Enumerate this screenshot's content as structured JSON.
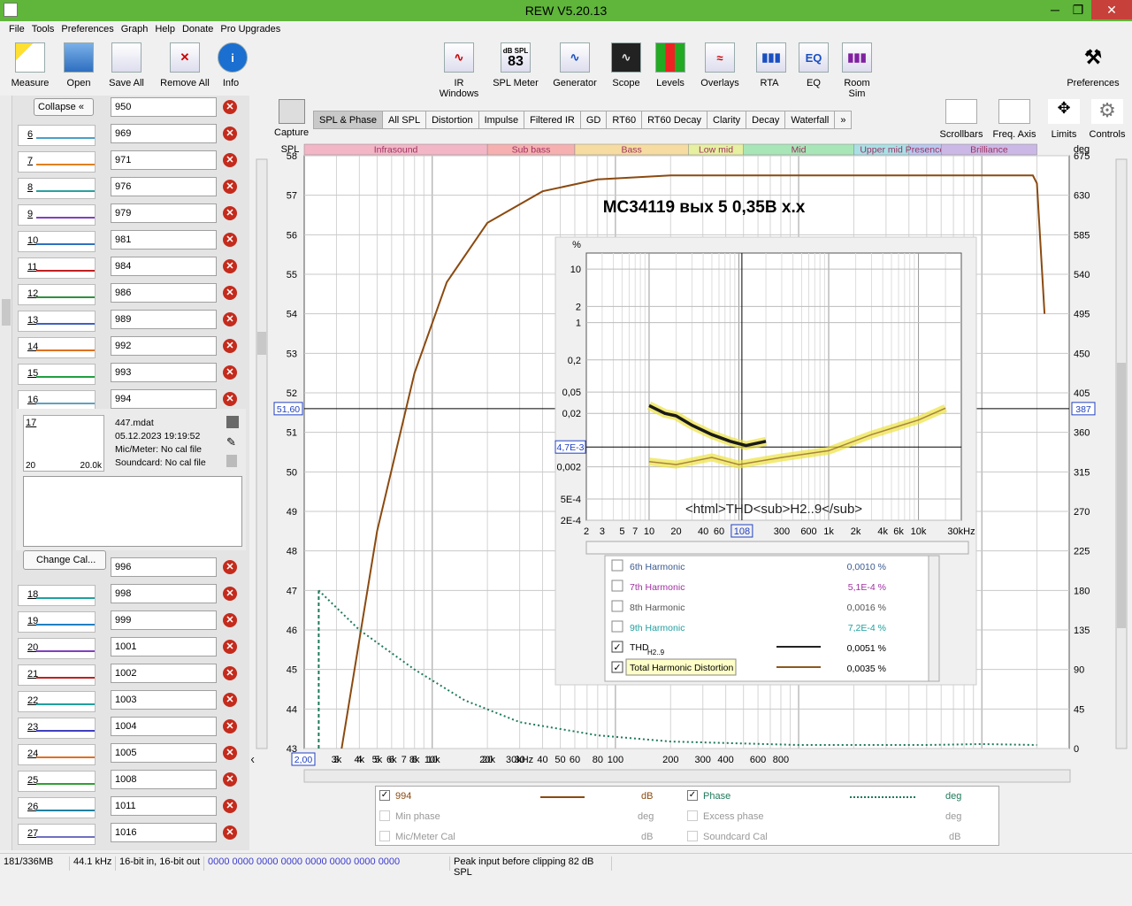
{
  "window": {
    "title": "REW V5.20.13",
    "minimize": "─",
    "restore": "❐",
    "close": "✕"
  },
  "menu": [
    "File",
    "Tools",
    "Preferences",
    "Graph",
    "Help",
    "Donate",
    "Pro Upgrades"
  ],
  "toolbar": {
    "measure": "Measure",
    "open": "Open",
    "save_all": "Save All",
    "remove_all": "Remove All",
    "info": "Info",
    "ir_windows": "IR Windows",
    "spl_meter": "SPL Meter",
    "spl_meter_label": "dB SPL",
    "spl_meter_value": "83",
    "generator": "Generator",
    "scope": "Scope",
    "levels": "Levels",
    "overlays": "Overlays",
    "rta": "RTA",
    "eq": "EQ",
    "eq_icon": "EQ",
    "room_sim": "Room Sim",
    "preferences": "Preferences"
  },
  "left": {
    "collapse": "Collapse",
    "collapse_icon": "«",
    "top_row_name": "950",
    "rows_top": [
      {
        "n": "6",
        "name": "969",
        "color": "#4aa0c8"
      },
      {
        "n": "7",
        "name": "971",
        "color": "#e08020"
      },
      {
        "n": "8",
        "name": "976",
        "color": "#2aa0a0"
      },
      {
        "n": "9",
        "name": "979",
        "color": "#8040c0"
      },
      {
        "n": "10",
        "name": "981",
        "color": "#3070c0"
      },
      {
        "n": "11",
        "name": "984",
        "color": "#c02020"
      },
      {
        "n": "12",
        "name": "986",
        "color": "#309040"
      },
      {
        "n": "13",
        "name": "989",
        "color": "#4060c0"
      },
      {
        "n": "14",
        "name": "992",
        "color": "#e07020"
      },
      {
        "n": "15",
        "name": "993",
        "color": "#20a040"
      },
      {
        "n": "16",
        "name": "994",
        "color": "#60a0c0"
      }
    ],
    "details": {
      "n": "17",
      "mini_left": "20",
      "mini_right": "20.0k",
      "file": "447.mdat",
      "date": "05.12.2023 19:19:52",
      "mic": "Mic/Meter: No cal file",
      "sound": "Soundcard: No cal file",
      "change_cal": "Change Cal...",
      "cal_name": "996"
    },
    "rows_bottom": [
      {
        "n": "18",
        "name": "998",
        "color": "#20a0a0"
      },
      {
        "n": "19",
        "name": "999",
        "color": "#2080c0"
      },
      {
        "n": "20",
        "name": "1001",
        "color": "#8040c0"
      },
      {
        "n": "21",
        "name": "1002",
        "color": "#c02020"
      },
      {
        "n": "22",
        "name": "1003",
        "color": "#20a0a0"
      },
      {
        "n": "23",
        "name": "1004",
        "color": "#4040c0"
      },
      {
        "n": "24",
        "name": "1005",
        "color": "#e07020"
      },
      {
        "n": "25",
        "name": "1008",
        "color": "#30a030"
      },
      {
        "n": "26",
        "name": "1011",
        "color": "#2080a0"
      },
      {
        "n": "27",
        "name": "1016",
        "color": "#7070c0"
      }
    ],
    "delete_icon": "✕"
  },
  "graph": {
    "capture": "Capture",
    "tabs": [
      "SPL & Phase",
      "All SPL",
      "Distortion",
      "Impulse",
      "Filtered IR",
      "GD",
      "RT60",
      "RT60 Decay",
      "Clarity",
      "Decay",
      "Waterfall",
      "»"
    ],
    "tools": {
      "scrollbars": "Scrollbars",
      "freq_axis": "Freq. Axis",
      "limits": "Limits",
      "controls": "Controls"
    },
    "bands": [
      {
        "label": "Infrasound",
        "color": "#f2b6c6"
      },
      {
        "label": "Sub bass",
        "color": "#f6b0b0"
      },
      {
        "label": "Bass",
        "color": "#f6dca0"
      },
      {
        "label": "Low mid",
        "color": "#e6f0a0"
      },
      {
        "label": "Mid",
        "color": "#a8e6b8"
      },
      {
        "label": "Upper mid",
        "color": "#a8e0e6"
      },
      {
        "label": "Presence",
        "color": "#b8c8f0"
      },
      {
        "label": "Brilliance",
        "color": "#cbb8e6"
      }
    ],
    "title": "MC34119 вых 5   0,35В х.х",
    "y_unit": "SPL",
    "y2_unit": "deg",
    "cursor_left": "51,60",
    "cursor_right": "387",
    "cursor_x": "2,00"
  },
  "chart_data": [
    {
      "type": "line",
      "title": "MC34119 вых 5   0,35В х.х",
      "xlabel": "",
      "ylabel": "SPL",
      "y2label": "deg",
      "xscale": "log",
      "xlim": [
        2,
        30000
      ],
      "ylim": [
        43,
        58
      ],
      "y2lim": [
        0,
        675
      ],
      "x_ticks": [
        "3",
        "4",
        "5",
        "6",
        "7",
        "8",
        "10",
        "20",
        "30",
        "40",
        "50",
        "60",
        "80",
        "100",
        "200",
        "300",
        "400",
        "600",
        "800",
        "1k",
        "2k",
        "3k",
        "4k",
        "5k",
        "6k",
        "8k",
        "10k",
        "20k",
        "30kHz"
      ],
      "y_ticks": [
        "43",
        "44",
        "45",
        "46",
        "47",
        "48",
        "49",
        "50",
        "51",
        "52",
        "53",
        "54",
        "55",
        "56",
        "57",
        "58"
      ],
      "y2_ticks": [
        "0",
        "45",
        "90",
        "135",
        "180",
        "225",
        "270",
        "315",
        "360",
        "405",
        "450",
        "495",
        "540",
        "585",
        "630",
        "675"
      ],
      "series": [
        {
          "name": "994",
          "color": "#8b4a10",
          "unit": "dB",
          "points": [
            [
              3.2,
              43
            ],
            [
              5,
              48.5
            ],
            [
              8,
              52.5
            ],
            [
              12,
              54.8
            ],
            [
              20,
              56.3
            ],
            [
              40,
              57.1
            ],
            [
              80,
              57.4
            ],
            [
              200,
              57.5
            ],
            [
              1000,
              57.5
            ],
            [
              10000,
              57.5
            ],
            [
              19000,
              57.5
            ],
            [
              20000,
              57.3
            ],
            [
              22000,
              54.0
            ]
          ]
        },
        {
          "name": "Phase",
          "color": "#1e7a5a",
          "unit": "deg",
          "points": [
            [
              2.4,
              180
            ],
            [
              4,
              135
            ],
            [
              8,
              90
            ],
            [
              15,
              55
            ],
            [
              30,
              30
            ],
            [
              80,
              15
            ],
            [
              200,
              8
            ],
            [
              1000,
              4
            ],
            [
              5000,
              4
            ],
            [
              10000,
              5
            ],
            [
              20000,
              4
            ]
          ]
        }
      ],
      "legend": {
        "placement": "bottom"
      }
    },
    {
      "type": "line",
      "title": "<html>THD<sub>H2..9</sub>",
      "xlabel": "",
      "ylabel": "%",
      "xscale": "log",
      "yscale": "log",
      "xlim": [
        2,
        30000
      ],
      "ylim": [
        0.0002,
        20
      ],
      "x_ticks": [
        "2",
        "3",
        "5",
        "7",
        "10",
        "20",
        "40",
        "60",
        "108",
        "300",
        "600",
        "1k",
        "2k",
        "4k",
        "6k",
        "10k",
        "30kHz"
      ],
      "y_ticks": [
        "10",
        "2",
        "1",
        "0,2",
        "0,05",
        "0,02",
        "0,002",
        "5E-4",
        "2E-4"
      ],
      "cursor_x": "108",
      "cursor_y": "4,7E-3",
      "series": [
        {
          "name": "THDH2..9",
          "color": "#1a1a1a",
          "value": "0,0051 %",
          "points": [
            [
              10,
              0.028
            ],
            [
              15,
              0.02
            ],
            [
              20,
              0.018
            ],
            [
              30,
              0.012
            ],
            [
              50,
              0.008
            ],
            [
              80,
              0.006
            ],
            [
              120,
              0.005
            ],
            [
              200,
              0.006
            ]
          ]
        },
        {
          "name": "Total Harmonic Distortion",
          "color": "#8b5a20",
          "value": "0,0035 %",
          "points": [
            [
              10,
              0.0025
            ],
            [
              20,
              0.0022
            ],
            [
              50,
              0.003
            ],
            [
              100,
              0.0022
            ],
            [
              300,
              0.003
            ],
            [
              1000,
              0.004
            ],
            [
              3000,
              0.008
            ],
            [
              10000,
              0.015
            ],
            [
              20000,
              0.025
            ]
          ]
        },
        {
          "name": "6th Harmonic",
          "value": "0,0010 %",
          "color": "#4060a0"
        },
        {
          "name": "7th Harmonic",
          "value": "5,1E-4 %",
          "color": "#a030a0"
        },
        {
          "name": "8th Harmonic",
          "value": "0,0016 %",
          "color": "#606060"
        },
        {
          "name": "9th Harmonic",
          "value": "7,2E-4 %",
          "color": "#20a0a0"
        }
      ]
    }
  ],
  "thd_legend": [
    {
      "label": "6th Harmonic",
      "value": "0,0010 %",
      "checked": false,
      "color": "#3a5a90"
    },
    {
      "label": "7th Harmonic",
      "value": "5,1E-4 %",
      "checked": false,
      "color": "#a030a0"
    },
    {
      "label": "8th Harmonic",
      "value": "0,0016 %",
      "checked": false,
      "color": "#555555"
    },
    {
      "label": "9th Harmonic",
      "value": "7,2E-4 %",
      "checked": false,
      "color": "#20a0a0"
    }
  ],
  "thd_main": {
    "label": "THD",
    "sub": "H2..9",
    "value": "0,0051 %"
  },
  "thd_total": {
    "label": "Total Harmonic Distortion",
    "value": "0,0035 %"
  },
  "bottom_legend": {
    "series1": "994",
    "series1_unit": "dB",
    "phase": "Phase",
    "phase_unit": "deg",
    "min_phase": "Min phase",
    "min_phase_unit": "deg",
    "excess_phase": "Excess phase",
    "excess_phase_unit": "deg",
    "mic_cal": "Mic/Meter Cal",
    "mic_cal_unit": "dB",
    "sound_cal": "Soundcard Cal",
    "sound_cal_unit": "dB"
  },
  "status": {
    "memory": "181/336MB",
    "rate": "44.1 kHz",
    "bits": "16-bit in, 16-bit out",
    "levels": "0000 0000  0000 0000  0000 0000  0000 0000",
    "peak": "Peak input before clipping 82 dB SPL"
  },
  "check_mark": "✓"
}
